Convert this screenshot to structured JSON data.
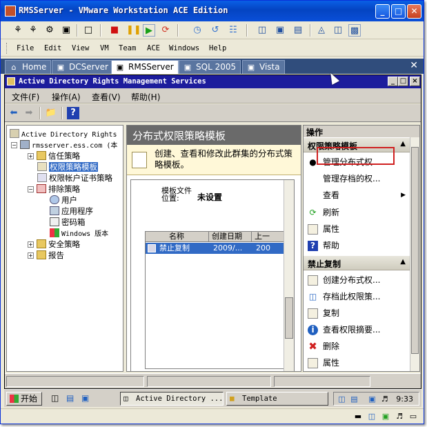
{
  "window": {
    "title": "RMSServer - VMware Workstation ACE Edition",
    "minimize": "_",
    "maximize": "□",
    "close": "✕"
  },
  "menu": [
    "File",
    "Edit",
    "View",
    "VM",
    "Team",
    "ACE",
    "Windows",
    "Help"
  ],
  "vm_tabs": [
    {
      "label": "Home",
      "icon": "home-icon"
    },
    {
      "label": "DCServer",
      "icon": "vm-icon"
    },
    {
      "label": "RMSServer",
      "icon": "vm-icon",
      "active": true
    },
    {
      "label": "SQL 2005",
      "icon": "vm-icon"
    },
    {
      "label": "Vista",
      "icon": "vm-icon"
    }
  ],
  "guest": {
    "title": "Active Directory Rights Management Services",
    "menu": [
      "文件(F)",
      "操作(A)",
      "查看(V)",
      "帮助(H)"
    ],
    "tree": [
      {
        "label": "Active Directory Rights",
        "mono": true
      },
      {
        "label": "rmsserver.ess.com (本",
        "mono": true
      },
      {
        "label": "信任策略"
      },
      {
        "label": "权限策略模板",
        "selected": true
      },
      {
        "label": "权限帐户证书策略"
      },
      {
        "label": "排除策略"
      },
      {
        "label": "用户"
      },
      {
        "label": "应用程序"
      },
      {
        "label": "密码箱"
      },
      {
        "label": "Windows 版本",
        "mono": true
      },
      {
        "label": "安全策略"
      },
      {
        "label": "报告"
      }
    ],
    "center": {
      "header": "分布式权限策略模板",
      "description": "创建、查看和修改此群集的分布式策略模板。",
      "property_label": "模板文件位置:",
      "property_value": "未设置",
      "columns": [
        "名称",
        "创建日期",
        "上一"
      ],
      "rows": [
        {
          "name": "禁止复制",
          "created": "2009/...",
          "last": "200"
        }
      ]
    },
    "actions": {
      "header": "操作",
      "section1": "权限策略模板",
      "section1_items": [
        "管理分布式权...",
        "管理存档的权...",
        "查看",
        "刷新",
        "属性",
        "帮助"
      ],
      "section2": "禁止复制",
      "section2_items": [
        "创建分布式权...",
        "存档此权限策...",
        "复制",
        "查看权限摘要...",
        "删除",
        "属性"
      ]
    }
  },
  "taskbar": {
    "start": "开始",
    "tasks": [
      "Active Directory ...",
      "Template"
    ],
    "clock": "9:33"
  }
}
